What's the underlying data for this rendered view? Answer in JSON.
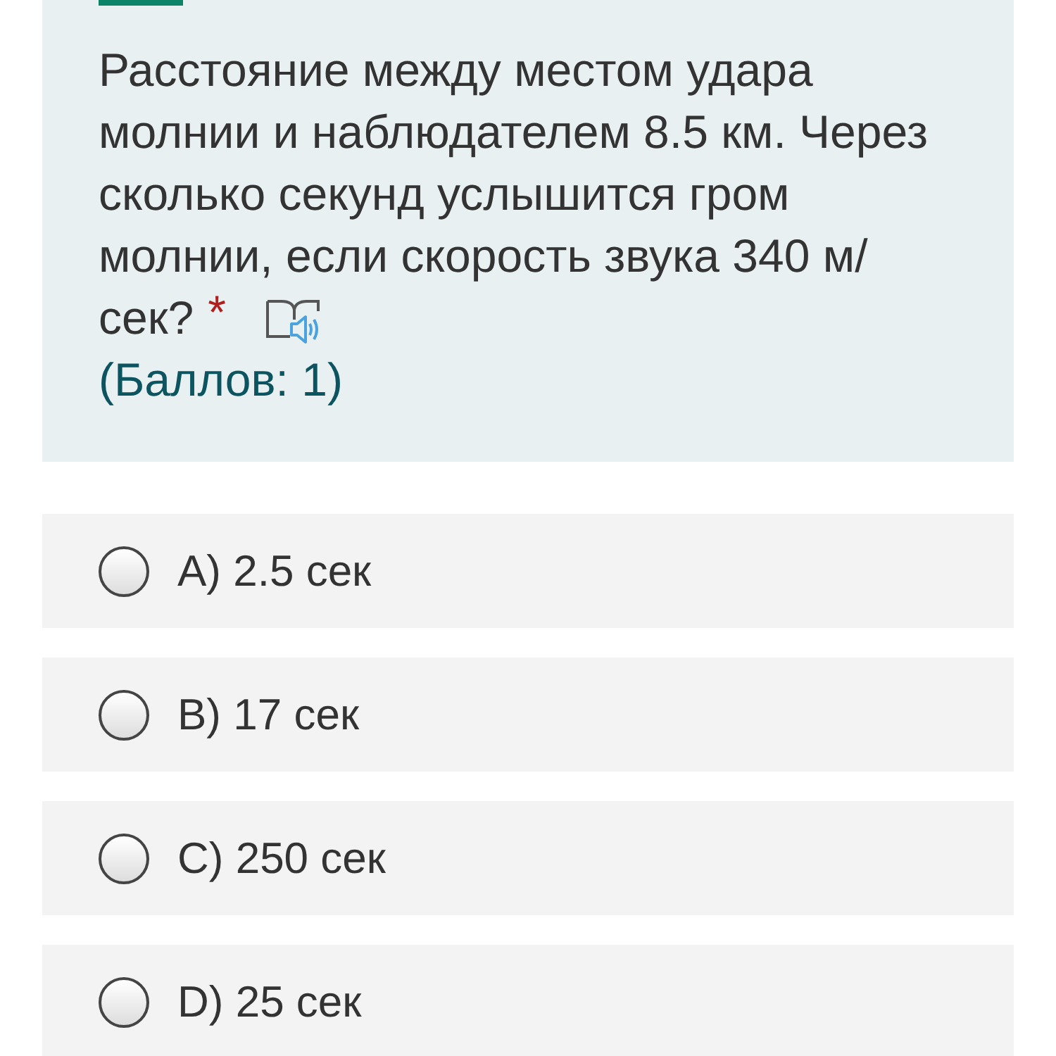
{
  "question": {
    "text": "Расстояние между местом удара молнии и наблюдателем 8.5 км. Через сколько секунд услышится гром молнии, если скорость звука 340 м/",
    "text_end": "сек?",
    "required": true,
    "required_mark": "*",
    "score": "(Баллов: 1)"
  },
  "options": [
    {
      "label": "A) 2.5 сек",
      "selected": false
    },
    {
      "label": "B) 17 сек",
      "selected": false
    },
    {
      "label": "C) 250 сек",
      "selected": false
    },
    {
      "label": "D) 25 сек",
      "selected": false
    }
  ]
}
